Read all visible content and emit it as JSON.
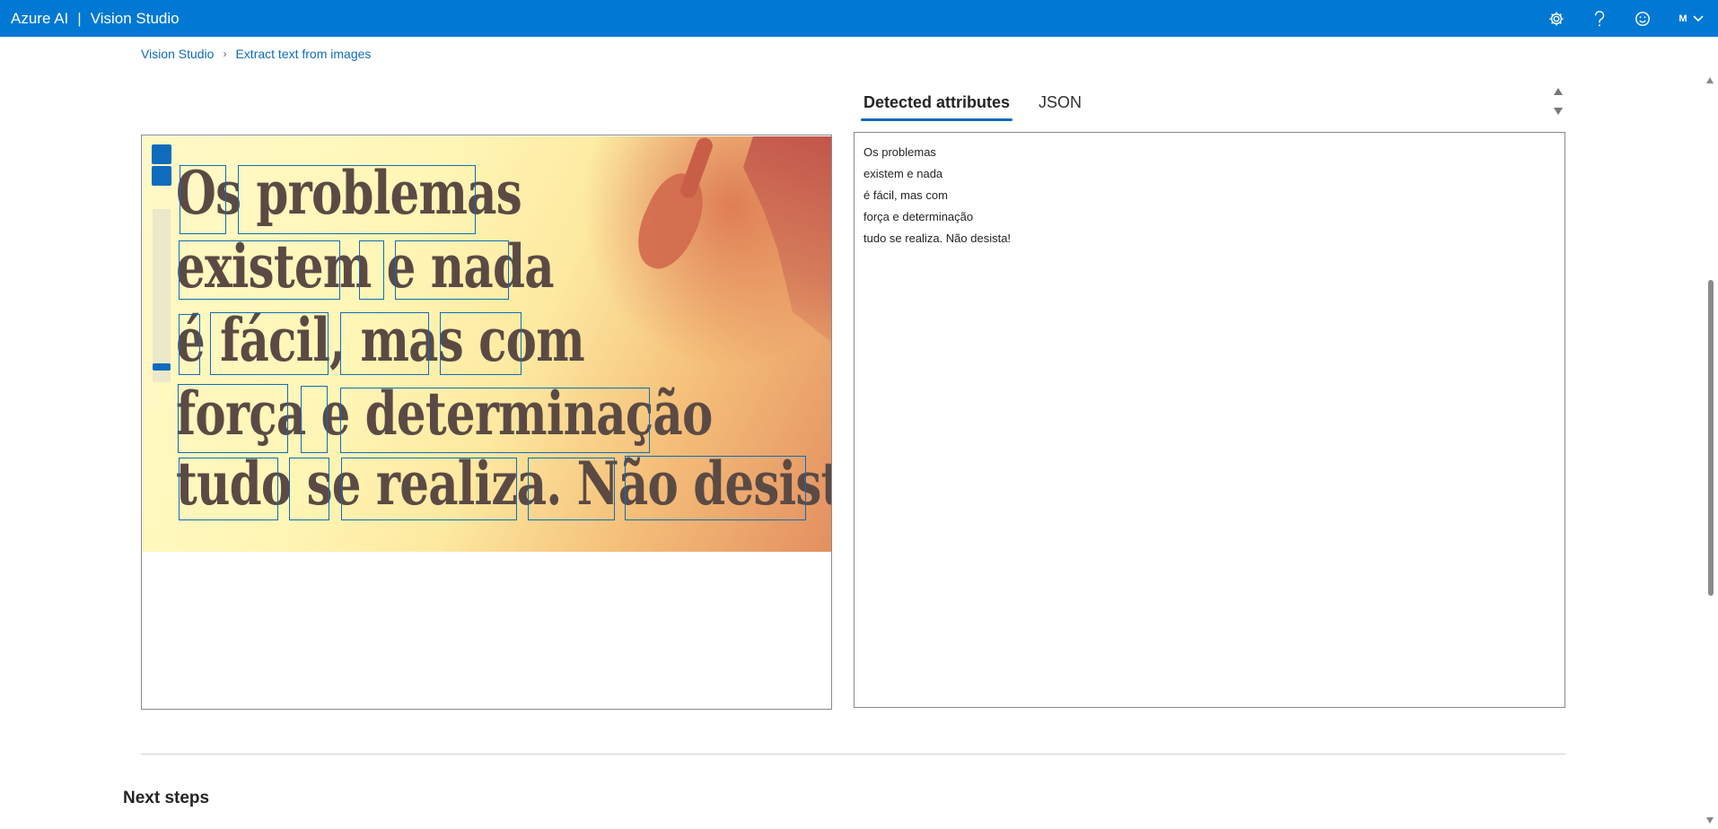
{
  "header": {
    "brand": "Azure AI",
    "separator": "|",
    "app_name": "Vision Studio",
    "user_initial": "M",
    "icons": [
      "gear-icon",
      "help-icon",
      "smiley-icon",
      "chevron-down-icon"
    ]
  },
  "breadcrumb": {
    "root": "Vision Studio",
    "current": "Extract text from images"
  },
  "tabs": [
    {
      "label": "Detected attributes",
      "active": true
    },
    {
      "label": "JSON",
      "active": false
    }
  ],
  "image": {
    "lines": [
      "Os problemas",
      "existem e nada",
      "é fácil, mas com",
      "força e determinação",
      "tudo se realiza. Não desista!"
    ]
  },
  "detected_text": [
    "Os problemas",
    "existem e nada",
    "é fácil, mas com",
    "força e determinação",
    "tudo se realiza. Não desista!"
  ],
  "next_steps": "Next steps",
  "colors": {
    "accent": "#0078d4",
    "link": "#0f6cbd",
    "bbox": "#0f6cbd"
  }
}
